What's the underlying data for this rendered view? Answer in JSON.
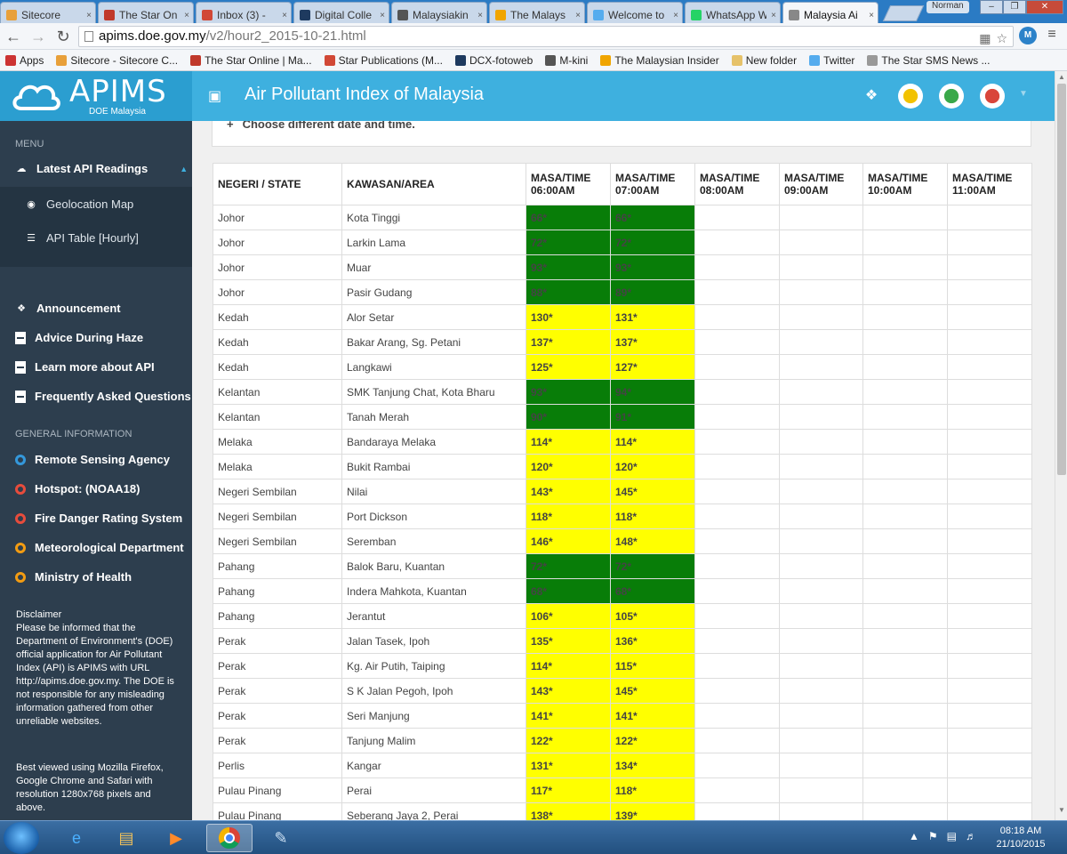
{
  "browser": {
    "tabs": [
      {
        "title": "Sitecore",
        "color": "#e8a03a"
      },
      {
        "title": "The Star On",
        "color": "#c0392b"
      },
      {
        "title": "Inbox (3) - ",
        "color": "#d14836"
      },
      {
        "title": "Digital Colle",
        "color": "#1e3a5f"
      },
      {
        "title": "Malaysiakin",
        "color": "#555555"
      },
      {
        "title": "The Malays",
        "color": "#f0a500"
      },
      {
        "title": "Welcome to",
        "color": "#55acee"
      },
      {
        "title": "WhatsApp W",
        "color": "#25d366"
      },
      {
        "title": "Malaysia Ai",
        "color": "#888888"
      }
    ],
    "user_badge": "Norman",
    "url_host": "apims.doe.gov.my",
    "url_path": "/v2/hour2_2015-10-21.html",
    "bookmarks": [
      {
        "label": "Apps"
      },
      {
        "label": "Sitecore - Sitecore C..."
      },
      {
        "label": "The Star Online | Ma..."
      },
      {
        "label": "Star Publications (M..."
      },
      {
        "label": "DCX-fotoweb"
      },
      {
        "label": "M-kini"
      },
      {
        "label": "The Malaysian Insider"
      },
      {
        "label": "New folder"
      },
      {
        "label": "Twitter"
      },
      {
        "label": "The Star SMS News ..."
      }
    ]
  },
  "header": {
    "logo": "APIMS",
    "logo_sub": "DOE Malaysia",
    "title": "Air Pollutant Index of Malaysia"
  },
  "sidebar": {
    "menu_heading": "MENU",
    "latest": "Latest API Readings",
    "sub_items": [
      "Geolocation Map",
      "API Table [Hourly]"
    ],
    "items": [
      "Announcement",
      "Advice During Haze",
      "Learn more about API",
      "Frequently Asked Questions"
    ],
    "general_heading": "GENERAL INFORMATION",
    "links": [
      {
        "label": "Remote Sensing Agency",
        "color": "#3498db"
      },
      {
        "label": "Hotspot: (NOAA18)",
        "color": "#e74c3c"
      },
      {
        "label": "Fire Danger Rating System",
        "color": "#e74c3c"
      },
      {
        "label": "Meteorological Department",
        "color": "#f39c12"
      },
      {
        "label": "Ministry of Health",
        "color": "#f39c12"
      }
    ],
    "disclaimer_title": "Disclaimer",
    "disclaimer_text": "Please be informed that the Department of Environment's (DOE) official application for Air Pollutant Index (API) is APIMS with URL http://apims.doe.gov.my. The DOE is not responsible for any misleading information gathered from other unreliable websites.",
    "best_viewed": "Best viewed using Mozilla Firefox, Google Chrome and Safari with resolution 1280x768 pixels and above."
  },
  "content": {
    "date_toggle": "Choose different date and time."
  },
  "table": {
    "headers": [
      "NEGERI / STATE",
      "KAWASAN/AREA",
      "MASA/TIME 06:00AM",
      "MASA/TIME 07:00AM",
      "MASA/TIME 08:00AM",
      "MASA/TIME 09:00AM",
      "MASA/TIME 10:00AM",
      "MASA/TIME 11:00AM"
    ],
    "colors": {
      "good": "#087d08",
      "moderate": "#ffff00"
    },
    "rows": [
      {
        "state": "Johor",
        "area": "Kota Tinggi",
        "t6": "66*",
        "t7": "66*",
        "level": "g"
      },
      {
        "state": "Johor",
        "area": "Larkin Lama",
        "t6": "72*",
        "t7": "72*",
        "level": "g"
      },
      {
        "state": "Johor",
        "area": "Muar",
        "t6": "93*",
        "t7": "93*",
        "level": "g"
      },
      {
        "state": "Johor",
        "area": "Pasir Gudang",
        "t6": "88*",
        "t7": "89*",
        "level": "g"
      },
      {
        "state": "Kedah",
        "area": "Alor Setar",
        "t6": "130*",
        "t7": "131*",
        "level": "y"
      },
      {
        "state": "Kedah",
        "area": "Bakar Arang, Sg. Petani",
        "t6": "137*",
        "t7": "137*",
        "level": "y"
      },
      {
        "state": "Kedah",
        "area": "Langkawi",
        "t6": "125*",
        "t7": "127*",
        "level": "y"
      },
      {
        "state": "Kelantan",
        "area": "SMK Tanjung Chat, Kota Bharu",
        "t6": "93*",
        "t7": "94*",
        "level": "g"
      },
      {
        "state": "Kelantan",
        "area": "Tanah Merah",
        "t6": "90*",
        "t7": "91*",
        "level": "g"
      },
      {
        "state": "Melaka",
        "area": "Bandaraya Melaka",
        "t6": "114*",
        "t7": "114*",
        "level": "y"
      },
      {
        "state": "Melaka",
        "area": "Bukit Rambai",
        "t6": "120*",
        "t7": "120*",
        "level": "y"
      },
      {
        "state": "Negeri Sembilan",
        "area": "Nilai",
        "t6": "143*",
        "t7": "145*",
        "level": "y"
      },
      {
        "state": "Negeri Sembilan",
        "area": "Port Dickson",
        "t6": "118*",
        "t7": "118*",
        "level": "y"
      },
      {
        "state": "Negeri Sembilan",
        "area": "Seremban",
        "t6": "146*",
        "t7": "148*",
        "level": "y"
      },
      {
        "state": "Pahang",
        "area": "Balok Baru, Kuantan",
        "t6": "72*",
        "t7": "72*",
        "level": "g"
      },
      {
        "state": "Pahang",
        "area": "Indera Mahkota, Kuantan",
        "t6": "68*",
        "t7": "68*",
        "level": "g"
      },
      {
        "state": "Pahang",
        "area": "Jerantut",
        "t6": "106*",
        "t7": "105*",
        "level": "y"
      },
      {
        "state": "Perak",
        "area": "Jalan Tasek, Ipoh",
        "t6": "135*",
        "t7": "136*",
        "level": "y"
      },
      {
        "state": "Perak",
        "area": "Kg. Air Putih, Taiping",
        "t6": "114*",
        "t7": "115*",
        "level": "y"
      },
      {
        "state": "Perak",
        "area": "S K Jalan Pegoh, Ipoh",
        "t6": "143*",
        "t7": "145*",
        "level": "y"
      },
      {
        "state": "Perak",
        "area": "Seri Manjung",
        "t6": "141*",
        "t7": "141*",
        "level": "y"
      },
      {
        "state": "Perak",
        "area": "Tanjung Malim",
        "t6": "122*",
        "t7": "122*",
        "level": "y"
      },
      {
        "state": "Perlis",
        "area": "Kangar",
        "t6": "131*",
        "t7": "134*",
        "level": "y"
      },
      {
        "state": "Pulau Pinang",
        "area": "Perai",
        "t6": "117*",
        "t7": "118*",
        "level": "y"
      },
      {
        "state": "Pulau Pinang",
        "area": "Seberang Jaya 2, Perai",
        "t6": "138*",
        "t7": "139*",
        "level": "y"
      }
    ]
  },
  "taskbar": {
    "time": "08:18 AM",
    "date": "21/10/2015"
  }
}
